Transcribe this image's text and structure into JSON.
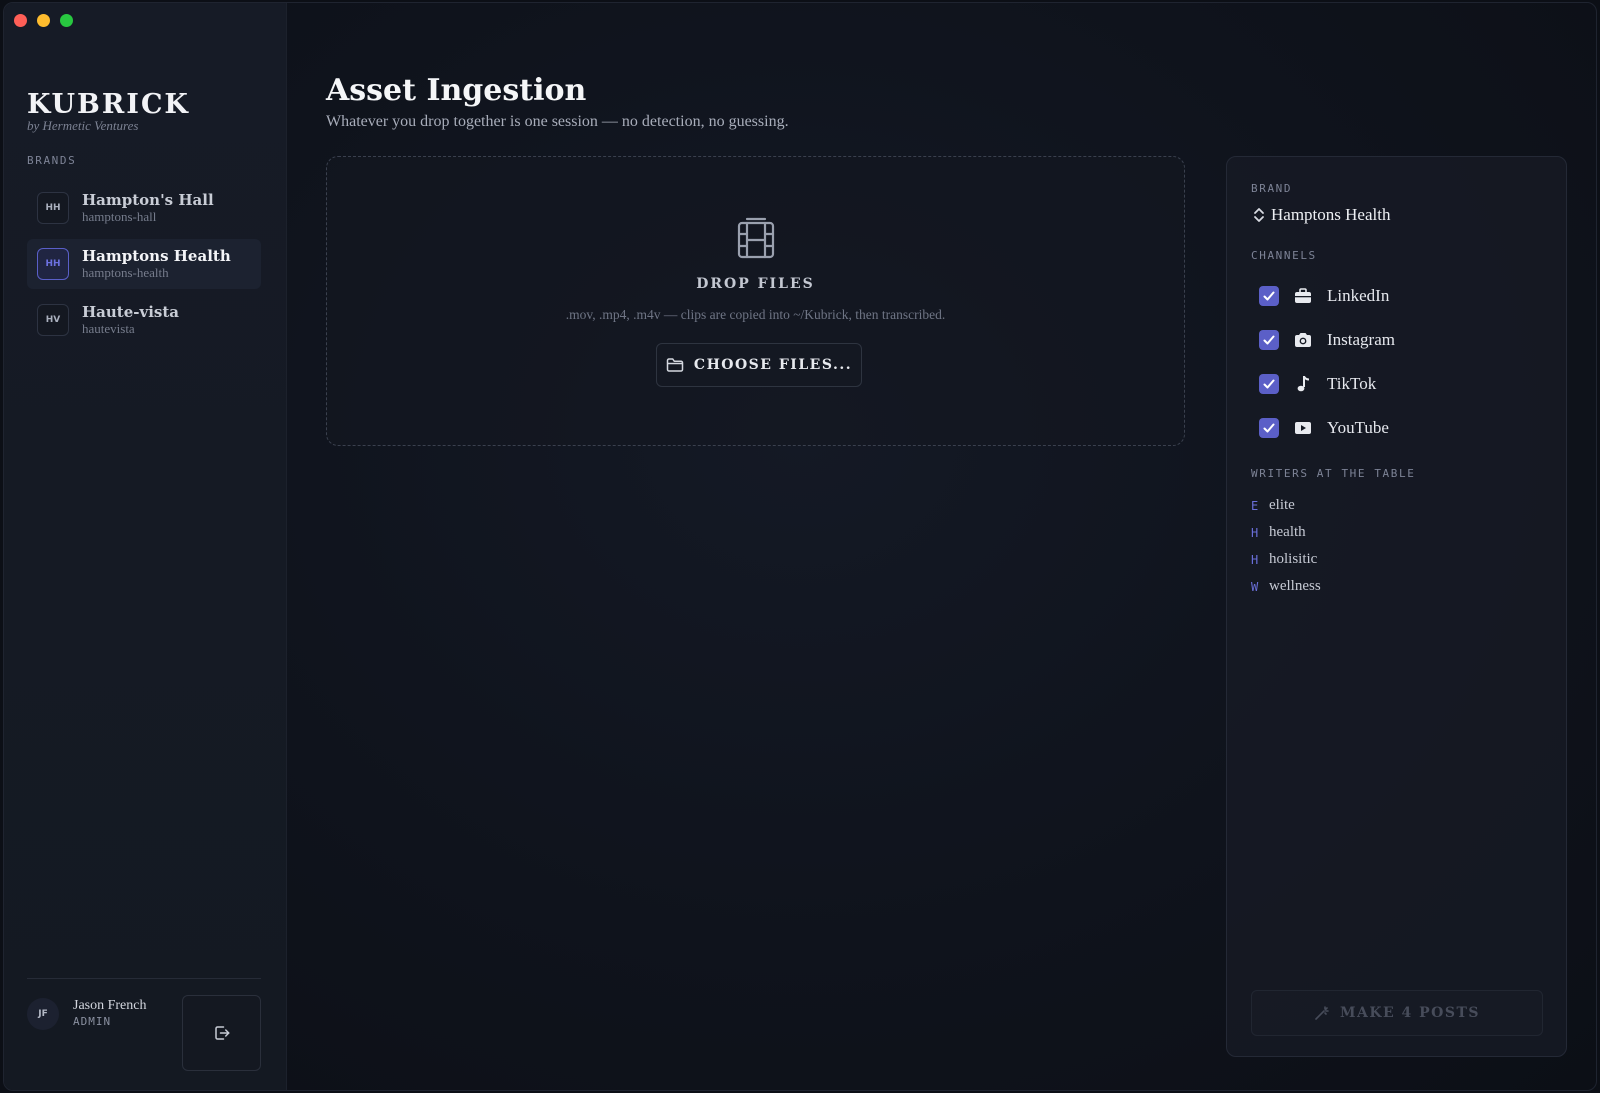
{
  "app": {
    "name": "KUBRICK",
    "tagline": "by Hermetic Ventures"
  },
  "sidebar": {
    "brands_label": "BRANDS",
    "brands": [
      {
        "initials": "HH",
        "name": "Hampton's Hall",
        "slug": "hamptons-hall",
        "active": false
      },
      {
        "initials": "HH",
        "name": "Hamptons Health",
        "slug": "hamptons-health",
        "active": true
      },
      {
        "initials": "HV",
        "name": "Haute-vista",
        "slug": "hautevista",
        "active": false
      }
    ],
    "user": {
      "initials": "JF",
      "name": "Jason French",
      "role": "ADMIN"
    }
  },
  "main": {
    "title": "Asset Ingestion",
    "subtitle": "Whatever you drop together is one session — no detection, no guessing.",
    "dropzone": {
      "title": "DROP FILES",
      "hint": ".mov, .mp4, .m4v — clips are copied into ~/Kubrick, then transcribed.",
      "button_label": "CHOOSE FILES..."
    }
  },
  "panel": {
    "brand_label": "BRAND",
    "brand_value": "Hamptons Health",
    "channels_label": "CHANNELS",
    "channels": [
      {
        "name": "LinkedIn",
        "icon": "briefcase-icon",
        "checked": true
      },
      {
        "name": "Instagram",
        "icon": "camera-icon",
        "checked": true
      },
      {
        "name": "TikTok",
        "icon": "music-note-icon",
        "checked": true
      },
      {
        "name": "YouTube",
        "icon": "play-icon",
        "checked": true
      }
    ],
    "writers_label": "WRITERS AT THE TABLE",
    "writers": [
      {
        "initial": "E",
        "name": "elite"
      },
      {
        "initial": "H",
        "name": "health"
      },
      {
        "initial": "H",
        "name": "holisitic"
      },
      {
        "initial": "W",
        "name": "wellness"
      }
    ],
    "make_button_label": "MAKE 4 POSTS"
  },
  "colors": {
    "accent": "#5b5fc7",
    "background": "#0c0f16",
    "sidebar": "#161b26"
  }
}
